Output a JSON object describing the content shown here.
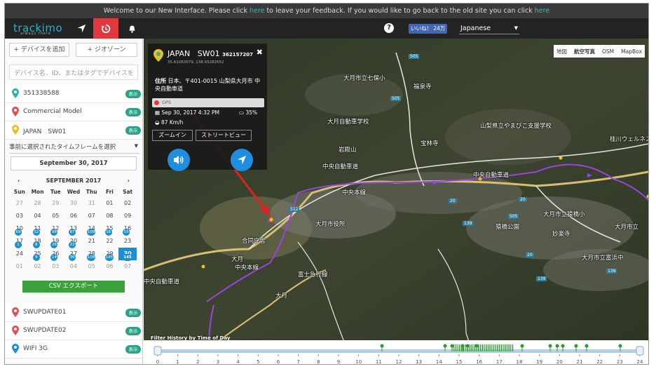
{
  "banner": {
    "pre": "Welcome to our New Interface. Please click ",
    "link1": "here",
    "mid": " to leave your feedback. If you would like to go back to the old site you can click ",
    "link2": "here"
  },
  "topbar": {
    "logo": "trackimo",
    "logo_tagline": "always there",
    "like_label": "いいね！ 24万",
    "language": "Japanese",
    "help_glyph": "?"
  },
  "sidebar": {
    "add_device": "+ デバイスを追加",
    "geozone": "+ ジオゾーン",
    "search_placeholder": "デバイス名、ID、またはタグでデバイスを",
    "devices_top": [
      {
        "name": "351338588",
        "badge": "表示",
        "pin_color": "#2bb3a3"
      },
      {
        "name": "Commercial Model",
        "badge": "表示",
        "pin_color": "#e05050"
      },
      {
        "name": "JAPAN　SW01",
        "badge": "表示",
        "pin_color": "#e8c020"
      }
    ],
    "timeframe": "事前に選択されたタイムフレームを選択",
    "selected_date": "September 30, 2017",
    "calendar": {
      "month": "SEPTEMBER 2017",
      "weekdays": [
        "Sun",
        "Mon",
        "Tue",
        "Wed",
        "Thu",
        "Fri",
        "Sat"
      ],
      "days": [
        {
          "d": "27",
          "out": true
        },
        {
          "d": "28",
          "out": true
        },
        {
          "d": "29",
          "out": true
        },
        {
          "d": "30",
          "out": true
        },
        {
          "d": "31",
          "out": true
        },
        {
          "d": "01"
        },
        {
          "d": "02"
        },
        {
          "d": "03"
        },
        {
          "d": "04"
        },
        {
          "d": "05"
        },
        {
          "d": "06"
        },
        {
          "d": "07"
        },
        {
          "d": "08"
        },
        {
          "d": "09"
        },
        {
          "d": "10",
          "c": "69"
        },
        {
          "d": "11",
          "c": "32"
        },
        {
          "d": "12",
          "c": "98"
        },
        {
          "d": "13",
          "c": "87"
        },
        {
          "d": "14",
          "c": "109"
        },
        {
          "d": "15",
          "c": "18"
        },
        {
          "d": "16",
          "c": "55"
        },
        {
          "d": "17",
          "c": "1"
        },
        {
          "d": "18",
          "c": "8"
        },
        {
          "d": "19",
          "c": "26"
        },
        {
          "d": "20",
          "c": "22"
        },
        {
          "d": "21"
        },
        {
          "d": "22"
        },
        {
          "d": "23"
        },
        {
          "d": "24"
        },
        {
          "d": "25",
          "c": "9"
        },
        {
          "d": "26",
          "c": "14"
        },
        {
          "d": "27",
          "c": "36"
        },
        {
          "d": "28",
          "c": "109"
        },
        {
          "d": "29",
          "c": "145"
        },
        {
          "d": "30",
          "c": "145",
          "sel": true
        },
        {
          "d": "01",
          "out": true
        },
        {
          "d": "02",
          "out": true
        },
        {
          "d": "03",
          "out": true
        },
        {
          "d": "04",
          "out": true
        },
        {
          "d": "05",
          "out": true
        },
        {
          "d": "06",
          "out": true
        },
        {
          "d": "07",
          "out": true
        }
      ]
    },
    "csv_export": "CSV エクスポート",
    "devices_bottom": [
      {
        "name": "SWUPDATE01",
        "badge": "表示",
        "pin_color": "#e05050"
      },
      {
        "name": "SWUPDATE02",
        "badge": "表示",
        "pin_color": "#e05050"
      },
      {
        "name": "WIFI 3G",
        "badge": "表示",
        "pin_color": "#1a8fd8"
      }
    ]
  },
  "map": {
    "types": [
      "地図",
      "航空写真",
      "OSM",
      "MapBox"
    ],
    "active_type": "航空写真",
    "labels": [
      "大月市立七保小",
      "福泉寺",
      "大月自動車学校",
      "山梨県立やまびこ支援学校",
      "宝林寺",
      "岩殿山",
      "中央自動車道",
      "中央自動車道",
      "中央本線",
      "大月市役所",
      "猿橋公園",
      "大月市立猿橋小",
      "大月市立",
      "妙楽寺",
      "大月市立富浜中",
      "合同庁舎",
      "大月",
      "中央本線",
      "中央自動車道",
      "桂川ウェルネスパーク",
      "505",
      "505",
      "512",
      "505",
      "20",
      "20",
      "139",
      "139",
      "20",
      "139",
      "大月",
      "富士急行線",
      "中央自動"
    ]
  },
  "popup": {
    "country": "JAPAN",
    "device": "SW01",
    "device_id": "362157207",
    "coords": "35.61083079, 138.93282652",
    "address_label": "住所",
    "address": "日本、〒401-0015 山梨県大月市 中央自動車道",
    "gps": "GPS",
    "time": "Sep 30, 2017 4:32 PM",
    "battery": "35%",
    "speed": "87 Km/h",
    "zoom_in": "ズームイン",
    "street_view": "ストリートビュー",
    "close_glyph": "✖"
  },
  "timeline": {
    "label": "Filter History by Time of Day",
    "hours": [
      "0",
      "1",
      "2",
      "3",
      "4",
      "5",
      "6",
      "7",
      "8",
      "9",
      "10",
      "11",
      "12",
      "13",
      "14",
      "15",
      "16",
      "17",
      "18",
      "19",
      "20",
      "21",
      "22",
      "23",
      "24"
    ]
  }
}
